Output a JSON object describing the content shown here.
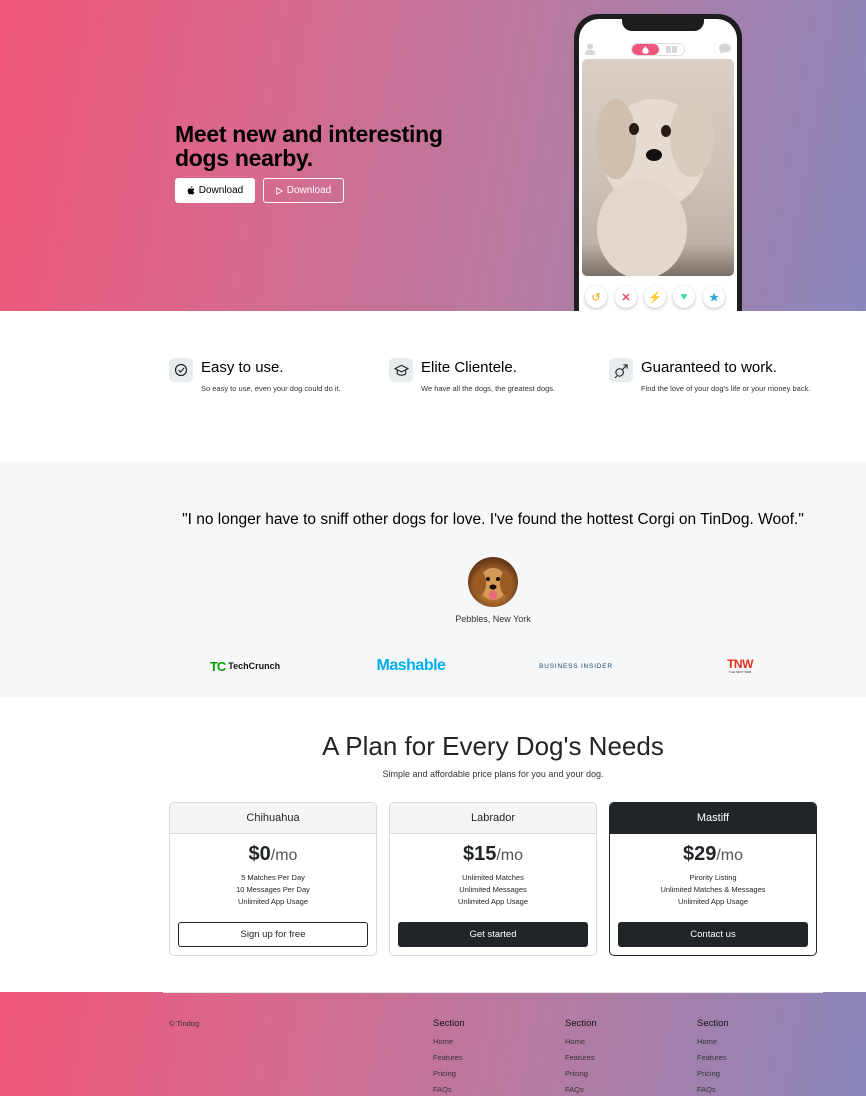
{
  "hero": {
    "title": "Meet new and interesting dogs nearby.",
    "apple_button": "Download",
    "play_button": "Download",
    "colors": {
      "gradient_start": "#f0567b",
      "gradient_end": "#8a87bb"
    }
  },
  "phone": {
    "icons": [
      "user-icon",
      "flame-icon",
      "group-icon",
      "chat-icon"
    ],
    "actions": [
      {
        "name": "rewind",
        "symbol": "↺",
        "color": "#f5b748"
      },
      {
        "name": "nope",
        "symbol": "✕",
        "color": "#ec4a5f"
      },
      {
        "name": "boost",
        "symbol": "⚡",
        "color": "#9152ee"
      },
      {
        "name": "like",
        "symbol": "♥",
        "color": "#3dd6a5"
      },
      {
        "name": "super-like",
        "symbol": "★",
        "color": "#2fa6d8"
      }
    ]
  },
  "features": [
    {
      "icon": "check-circle-icon",
      "title": "Easy to use.",
      "text": "So easy to use, even your dog could do it."
    },
    {
      "icon": "graduation-cap-icon",
      "title": "Elite Clientele.",
      "text": "We have all the dogs, the greatest dogs."
    },
    {
      "icon": "heart-gender-icon",
      "title": "Guaranteed to work.",
      "text": "Find the love of your dog's life or your money back."
    }
  ],
  "testimonial": {
    "quote": "\"I no longer have to sniff other dogs for love. I've found the hottest Corgi on TinDog. Woof.\"",
    "author": "Pebbles, New York"
  },
  "press": {
    "techcrunch": "TechCrunch",
    "tc_mark": "TC",
    "mashable": "Mashable",
    "business_insider": "BUSINESS INSIDER",
    "tnw": "TNW",
    "tnw_sub": "THE NEXT WEB"
  },
  "pricing": {
    "title": "A Plan for Every Dog's Needs",
    "subtitle": "Simple and affordable price plans for you and your dog.",
    "plans": [
      {
        "name": "Chihuahua",
        "price": "$0",
        "per": "/mo",
        "features": [
          "5 Matches Per Day",
          "10 Messages Per Day",
          "Unlimited App Usage"
        ],
        "button": "Sign up for free"
      },
      {
        "name": "Labrador",
        "price": "$15",
        "per": "/mo",
        "features": [
          "Unlimited Matches",
          "Unlimited Messages",
          "Unlimited App Usage"
        ],
        "button": "Get started"
      },
      {
        "name": "Mastiff",
        "price": "$29",
        "per": "/mo",
        "features": [
          "Pirority Listing",
          "Unlimited Matches & Messages",
          "Unlimited App Usage"
        ],
        "button": "Contact us"
      }
    ]
  },
  "footer": {
    "copyright": "© Tindog",
    "columns": [
      {
        "title": "Section",
        "links": [
          "Home",
          "Features",
          "Pricing",
          "FAQs"
        ]
      },
      {
        "title": "Section",
        "links": [
          "Home",
          "Features",
          "Pricing",
          "FAQs"
        ]
      },
      {
        "title": "Section",
        "links": [
          "Home",
          "Features",
          "Pricing",
          "FAQs"
        ]
      }
    ]
  }
}
